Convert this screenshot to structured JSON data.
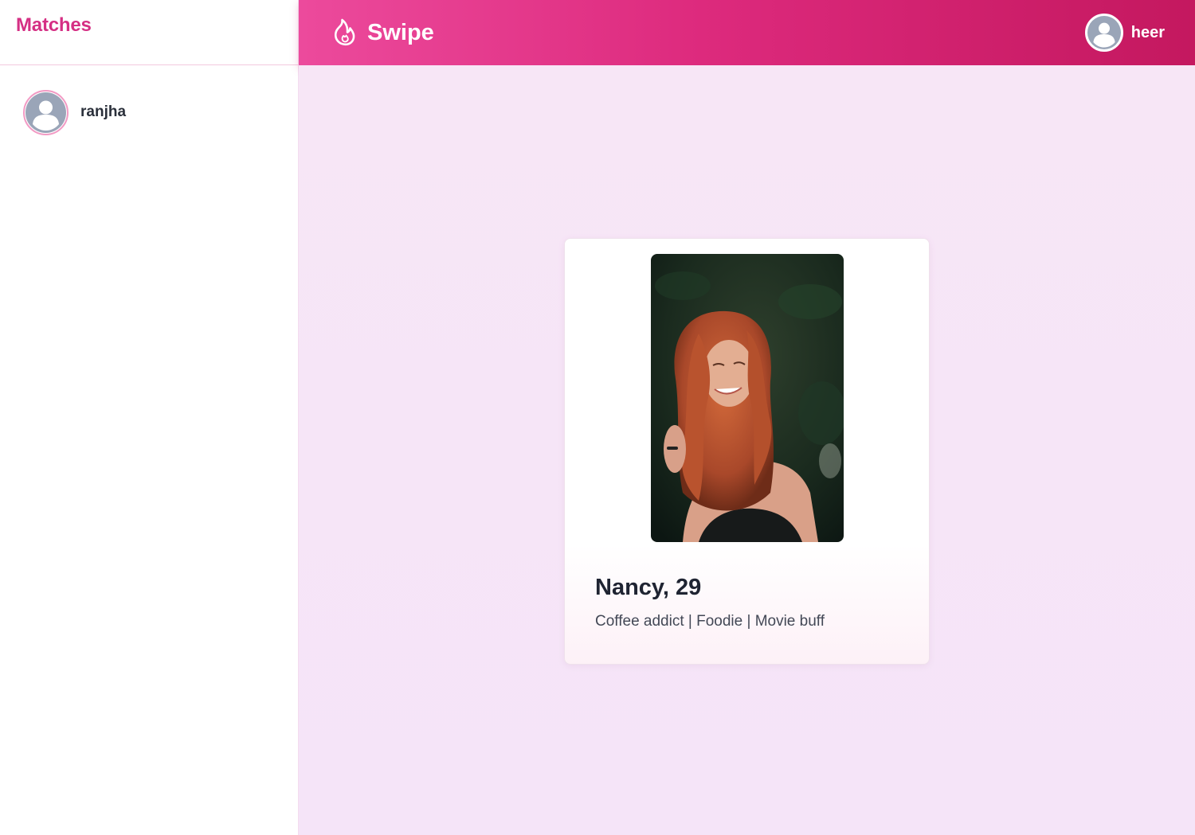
{
  "sidebar": {
    "title": "Matches",
    "matches": [
      {
        "name": "ranjha",
        "avatar_icon": "user-avatar-placeholder-icon"
      }
    ]
  },
  "header": {
    "brand": "Swipe",
    "brand_icon": "flame-icon",
    "user": {
      "name": "heer",
      "avatar_icon": "user-avatar-placeholder-icon"
    }
  },
  "card": {
    "name_age": "Nancy, 29",
    "bio": "Coffee addict | Foodie | Movie buff",
    "photo_alt": "Nancy"
  },
  "colors": {
    "brand_pink": "#d52f84",
    "header_gradient_start": "#ec4a9c",
    "header_gradient_end": "#c4185f",
    "background": "#f7e6f6"
  }
}
